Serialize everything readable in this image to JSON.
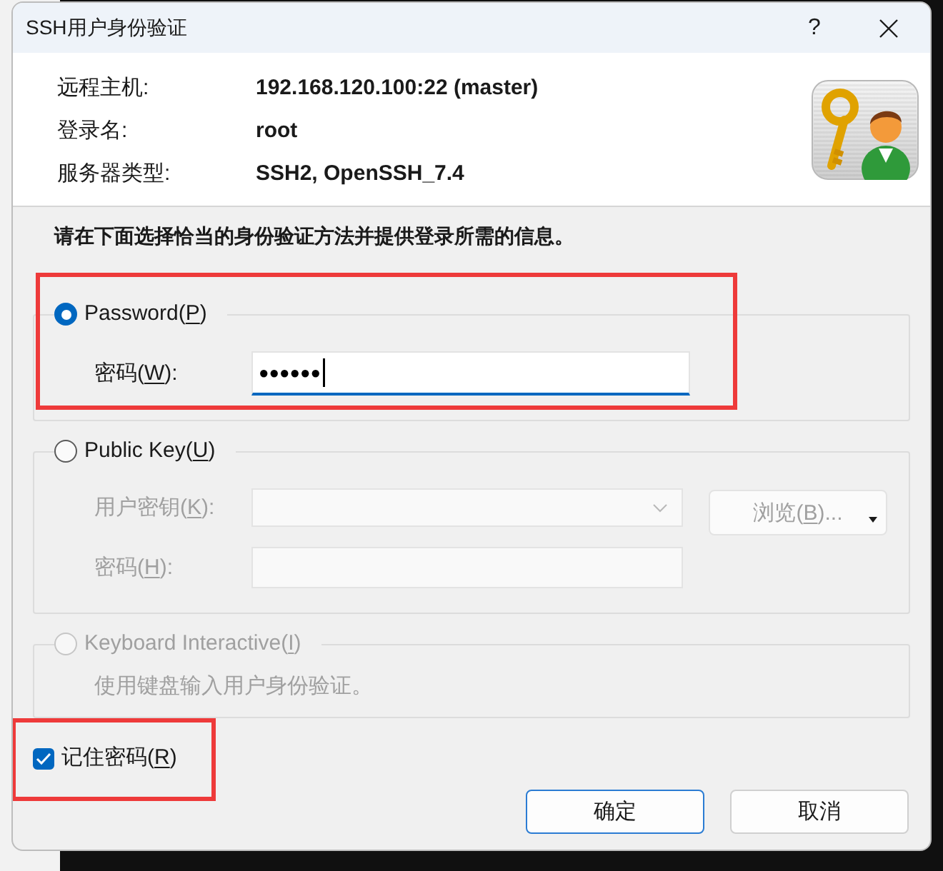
{
  "window": {
    "title": "SSH用户身份验证",
    "help": "?"
  },
  "info": [
    {
      "label": "远程主机:",
      "value": "192.168.120.100:22 (master)"
    },
    {
      "label": "登录名:",
      "value": "root"
    },
    {
      "label": "服务器类型:",
      "value": "SSH2, OpenSSH_7.4"
    }
  ],
  "instruction": "请在下面选择恰当的身份验证方法并提供登录所需的信息。",
  "show_access_keys": true,
  "methods": [
    {
      "label": "Password(P)",
      "selected": true,
      "disabled": false,
      "highlighted": true,
      "fields": [
        {
          "kind": "password",
          "label": "密码(W):",
          "value": "●●●●●●",
          "focused": true,
          "disabled": false
        }
      ]
    },
    {
      "label": "Public Key(U)",
      "selected": false,
      "disabled": false,
      "highlighted": false,
      "fields": [
        {
          "kind": "combo",
          "label": "用户密钥(K):",
          "focused": false,
          "disabled": true
        },
        {
          "kind": "text",
          "label": "密码(H):",
          "focused": false,
          "disabled": true
        }
      ],
      "browse": {
        "label": "浏览(B)...",
        "disabled": true
      }
    },
    {
      "label": "Keyboard Interactive(I)",
      "selected": false,
      "disabled": true,
      "highlighted": false,
      "description": "使用键盘输入用户身份验证。"
    }
  ],
  "remember": {
    "label": "记住密码(R)",
    "checked": true,
    "highlighted": true
  },
  "buttons": [
    {
      "label": "确定",
      "default": true
    },
    {
      "label": "取消",
      "default": false
    }
  ]
}
